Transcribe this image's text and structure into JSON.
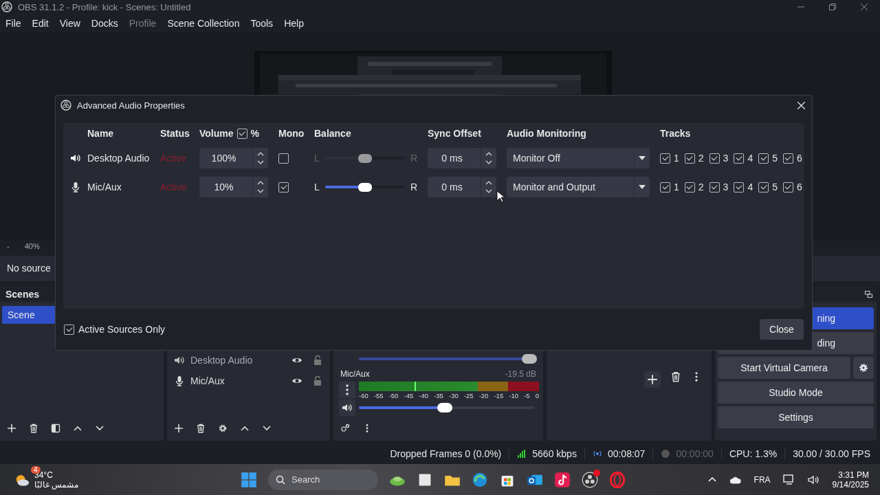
{
  "window": {
    "title": "OBS 31.1.2 - Profile: kick - Scenes: Untitled"
  },
  "menu": [
    {
      "label": "File",
      "disabled": false
    },
    {
      "label": "Edit",
      "disabled": false
    },
    {
      "label": "View",
      "disabled": false
    },
    {
      "label": "Docks",
      "disabled": false
    },
    {
      "label": "Profile",
      "disabled": true
    },
    {
      "label": "Scene Collection",
      "disabled": false
    },
    {
      "label": "Tools",
      "disabled": false
    },
    {
      "label": "Help",
      "disabled": false
    }
  ],
  "preview": {
    "kind": "picture",
    "zoom_out": "-",
    "zoom": "40%"
  },
  "source_bar": {
    "text": "No source"
  },
  "scenes": {
    "title": "Scenes",
    "items": [
      {
        "label": "Scene",
        "selected": true
      }
    ]
  },
  "sources": {
    "items": [
      {
        "name": "Desktop Audio",
        "kind": "speaker"
      },
      {
        "name": "Mic/Aux",
        "kind": "mic"
      }
    ]
  },
  "mixer": {
    "channels": [
      {
        "level": 0.97
      },
      {
        "name": "Mic/Aux",
        "reading": "-19.5 dB",
        "meter": {
          "level": 0.31
        },
        "level": 0.49
      }
    ],
    "scale": [
      "-60",
      "-55",
      "-50",
      "-45",
      "-40",
      "-35",
      "-30",
      "-25",
      "-20",
      "-15",
      "-10",
      "-5",
      "0"
    ]
  },
  "controls": {
    "buttons": [
      {
        "label": "ning",
        "kind": "primary"
      },
      {
        "label": "ding",
        "kind": "partial"
      },
      {
        "label": "Start Virtual Camera",
        "kind": "with-settings"
      },
      {
        "label": "Studio Mode",
        "kind": "plain"
      },
      {
        "label": "Settings",
        "kind": "plain"
      }
    ]
  },
  "dialog": {
    "title": "Advanced Audio Properties",
    "columns": [
      {
        "label": "Name"
      },
      {
        "label": "Status"
      },
      {
        "label": "Volume",
        "toggle": {
          "label": "%",
          "checked": true
        }
      },
      {
        "label": "Mono"
      },
      {
        "label": "Balance"
      },
      {
        "label": "Sync Offset"
      },
      {
        "label": "Audio Monitoring"
      },
      {
        "label": "Tracks"
      }
    ],
    "rows": [
      {
        "name": "Desktop Audio",
        "kind": "speaker",
        "status": "Active",
        "volume": "100%",
        "mono": false,
        "balance": {
          "left": "L",
          "right": "R",
          "level": 0.5,
          "disabled": true
        },
        "sync": "0 ms",
        "monitoring": "Monitor Off",
        "tracks": [
          {
            "label": "1",
            "checked": true
          },
          {
            "label": "2",
            "checked": true
          },
          {
            "label": "3",
            "checked": true
          },
          {
            "label": "4",
            "checked": true
          },
          {
            "label": "5",
            "checked": true
          },
          {
            "label": "6",
            "checked": true
          }
        ]
      },
      {
        "name": "Mic/Aux",
        "kind": "mic",
        "status": "Active",
        "volume": "10%",
        "mono": true,
        "balance": {
          "left": "L",
          "right": "R",
          "level": 0.5,
          "disabled": false
        },
        "sync": "0 ms",
        "monitoring": "Monitor and Output",
        "tracks": [
          {
            "label": "1",
            "checked": true
          },
          {
            "label": "2",
            "checked": true
          },
          {
            "label": "3",
            "checked": true
          },
          {
            "label": "4",
            "checked": true
          },
          {
            "label": "5",
            "checked": true
          },
          {
            "label": "6",
            "checked": true
          }
        ]
      }
    ],
    "active_only": {
      "label": "Active Sources Only",
      "checked": true
    },
    "close_button": "Close"
  },
  "status_bar": {
    "dropped": "Dropped Frames 0 (0.0%)",
    "bitrate": "5660 kbps",
    "stream_time": "00:08:07",
    "record_time": "00:00:00",
    "cpu": "CPU: 1.3%",
    "fps": "30.00 / 30.00 FPS"
  },
  "taskbar": {
    "weather": {
      "badge": "4",
      "temp": "34°C",
      "text": "مشمس غالبًا"
    },
    "search": {
      "placeholder": "Search"
    },
    "language": "FRA",
    "time": "3:31 PM",
    "date": "9/14/2025"
  }
}
